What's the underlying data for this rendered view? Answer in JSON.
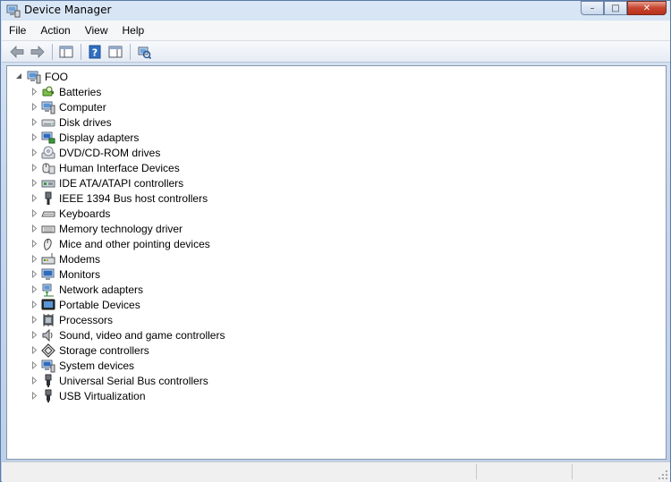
{
  "window": {
    "title": "Device Manager",
    "minimize": "–",
    "maximize": "□",
    "close": "✕"
  },
  "menubar": {
    "items": [
      "File",
      "Action",
      "View",
      "Help"
    ]
  },
  "toolbar": {
    "buttons": [
      "back-arrow-icon",
      "forward-arrow-icon",
      "properties-icon",
      "help-icon",
      "show-hide-console-tree-icon",
      "scan-hardware-changes-icon"
    ]
  },
  "tree": {
    "root": {
      "label": "FOO",
      "icon": "computer-icon",
      "expanded": true
    },
    "categories": [
      {
        "label": "Batteries",
        "icon": "battery-icon"
      },
      {
        "label": "Computer",
        "icon": "computer-icon"
      },
      {
        "label": "Disk drives",
        "icon": "disk-drive-icon"
      },
      {
        "label": "Display adapters",
        "icon": "display-adapter-icon"
      },
      {
        "label": "DVD/CD-ROM drives",
        "icon": "dvd-drive-icon"
      },
      {
        "label": "Human Interface Devices",
        "icon": "hid-icon"
      },
      {
        "label": "IDE ATA/ATAPI controllers",
        "icon": "ide-controller-icon"
      },
      {
        "label": "IEEE 1394 Bus host controllers",
        "icon": "firewire-icon"
      },
      {
        "label": "Keyboards",
        "icon": "keyboard-icon"
      },
      {
        "label": "Memory technology driver",
        "icon": "memory-icon"
      },
      {
        "label": "Mice and other pointing devices",
        "icon": "mouse-icon"
      },
      {
        "label": "Modems",
        "icon": "modem-icon"
      },
      {
        "label": "Monitors",
        "icon": "monitor-icon"
      },
      {
        "label": "Network adapters",
        "icon": "network-adapter-icon"
      },
      {
        "label": "Portable Devices",
        "icon": "portable-device-icon"
      },
      {
        "label": "Processors",
        "icon": "processor-icon"
      },
      {
        "label": "Sound, video and game controllers",
        "icon": "sound-icon"
      },
      {
        "label": "Storage controllers",
        "icon": "storage-controller-icon"
      },
      {
        "label": "System devices",
        "icon": "system-devices-icon"
      },
      {
        "label": "Universal Serial Bus controllers",
        "icon": "usb-icon"
      },
      {
        "label": "USB Virtualization",
        "icon": "usb-icon"
      }
    ]
  },
  "statusbar": {
    "text": ""
  },
  "colors": {
    "titlebar": "#c6d7ee",
    "menubar": "#f5f6f7",
    "tree_bg": "#ffffff",
    "close_button": "#c7452f"
  }
}
